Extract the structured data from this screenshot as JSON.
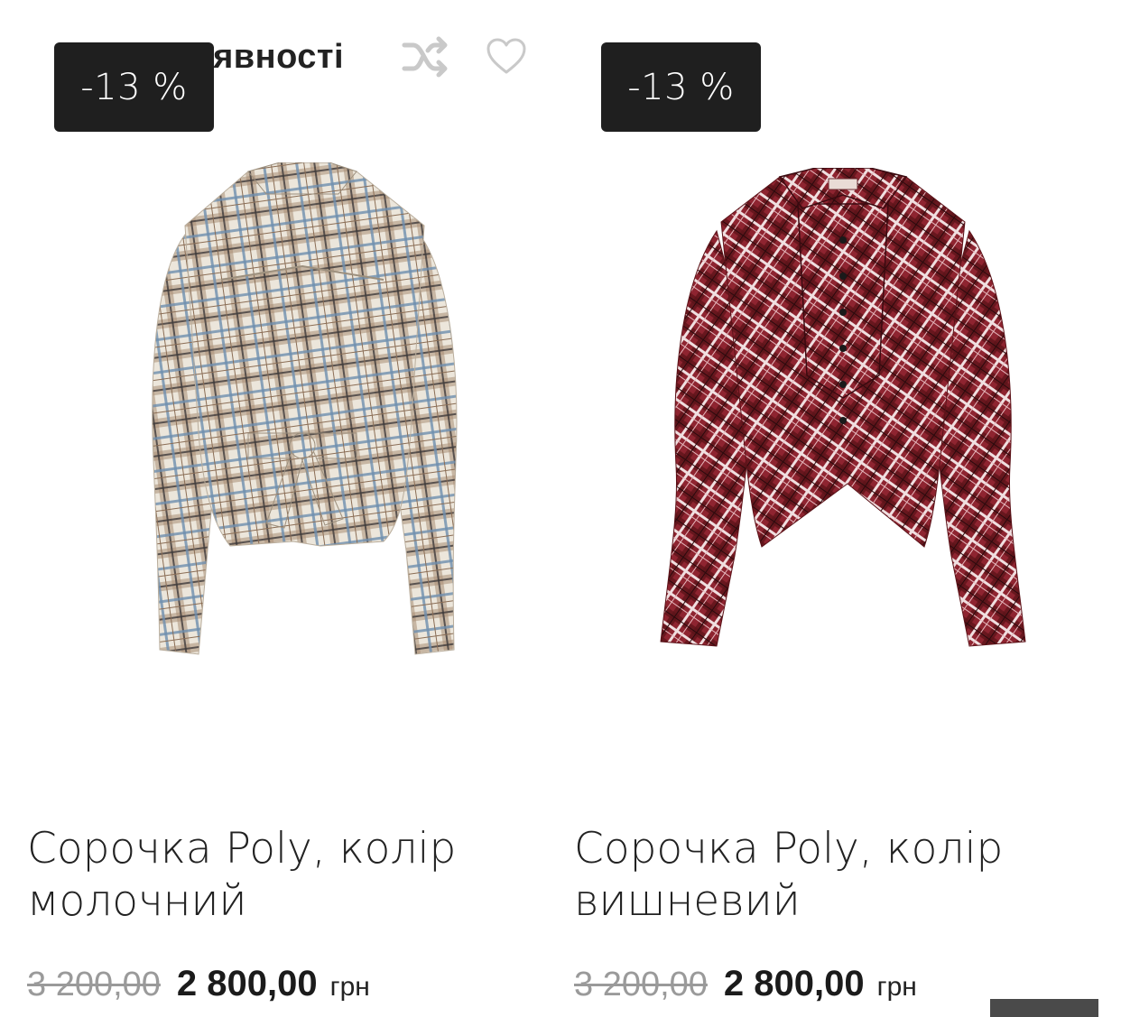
{
  "products": [
    {
      "stock_label": "В наявності",
      "discount": "-13 %",
      "title": "Сорочка Poly, колір молочний",
      "old_price": "3 200,00",
      "new_price": "2 800,00",
      "currency": "грн",
      "image_icon": "plaid-shirt-milky-image"
    },
    {
      "discount": "-13 %",
      "title": "Сорочка Poly, колір вишневий",
      "old_price": "3 200,00",
      "new_price": "2 800,00",
      "currency": "грн",
      "image_icon": "plaid-shirt-cherry-image"
    }
  ],
  "icons": {
    "shuffle": "shuffle-icon",
    "wishlist": "heart-icon"
  },
  "colors": {
    "badge_bg": "#1f1f1f",
    "in_stock_dot": "#26a33a",
    "old_price": "#9a9a9a",
    "shirt_milky_base": "#e9e3d8",
    "shirt_milky_lines": "#8a6d55",
    "shirt_milky_blue": "#6e8eae",
    "shirt_cherry_base": "#8e2430",
    "shirt_cherry_lines": "#f0dfe0"
  }
}
